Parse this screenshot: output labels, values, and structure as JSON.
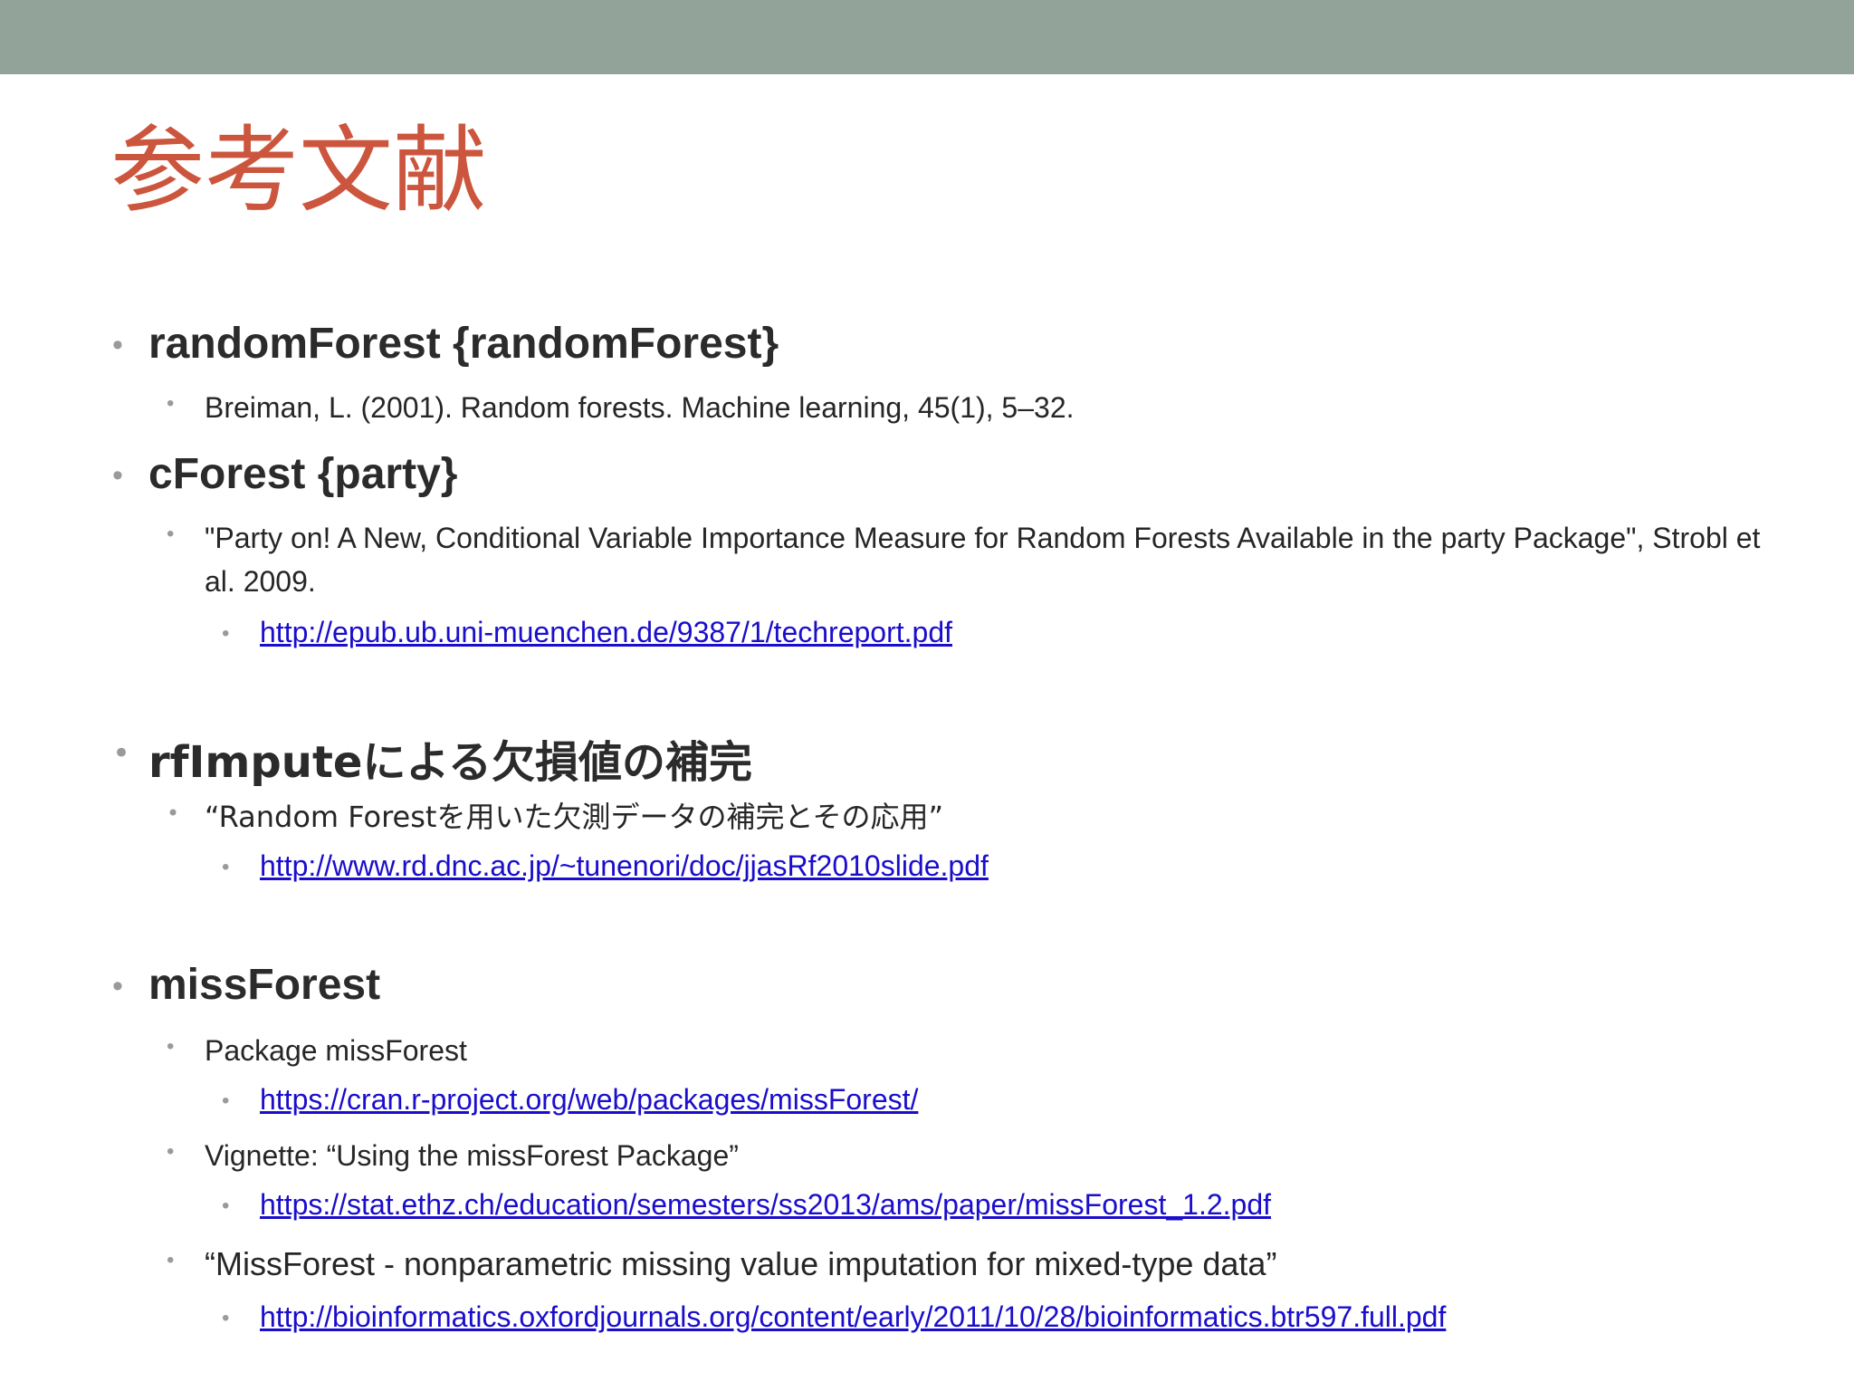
{
  "title": "参考文献",
  "bullet_glyph": "•",
  "sections": [
    {
      "heading": "randomForest {randomForest}",
      "items": [
        {
          "text": "Breiman, L. (2001). Random forests. Machine learning, 45(1), 5–32."
        }
      ]
    },
    {
      "heading": "cForest {party}",
      "items": [
        {
          "text": "\"Party on! A New, Conditional Variable Importance Measure for Random Forests Available in the party Package\", Strobl et al. 2009.",
          "link": "http://epub.ub.uni-muenchen.de/9387/1/techreport.pdf"
        }
      ]
    },
    {
      "heading": "rfImputeによる欠損値の補完",
      "items": [
        {
          "text": "“Random Forestを用いた欠測データの補完とその応用”",
          "link": "http://www.rd.dnc.ac.jp/~tunenori/doc/jjasRf2010slide.pdf"
        }
      ]
    },
    {
      "heading": "missForest",
      "items": [
        {
          "text": "Package missForest",
          "link": "https://cran.r-project.org/web/packages/missForest/"
        },
        {
          "text": "Vignette: “Using the missForest Package”",
          "link": "https://stat.ethz.ch/education/semesters/ss2013/ams/paper/missForest_1.2.pdf"
        },
        {
          "text": "“MissForest - nonparametric missing value imputation for mixed-type data”",
          "link": "http://bioinformatics.oxfordjournals.org/content/early/2011/10/28/bioinformatics.btr597.full.pdf"
        }
      ]
    }
  ]
}
